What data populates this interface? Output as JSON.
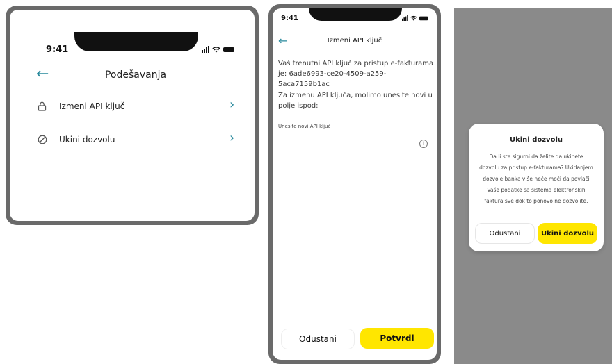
{
  "screen1": {
    "time": "9:41",
    "title": "Podešavanja",
    "items": [
      {
        "label": "Izmeni API ključ",
        "icon": "lock-icon"
      },
      {
        "label": "Ukini dozvolu",
        "icon": "block-icon"
      }
    ]
  },
  "screen2": {
    "time": "9:41",
    "title": "Izmeni API ključ",
    "current_key_text": "Vaš trenutni API ključ za pristup e-fakturama je: 6ade6993-ce20-4509-a259-5aca7159b1ac",
    "instruction": "Za izmenu API ključa, molimo unesite novi u polje ispod:",
    "field_label": "Unesite novi API ključ",
    "field_value": "",
    "cancel_label": "Odustani",
    "confirm_label": "Potvrdi"
  },
  "dialog": {
    "title": "Ukini dozvolu",
    "body": "Da li ste sigurni da želite da ukinete dozvolu za pristup e-fakturama? Ukidanjem dozvole banka više neće moći da povlači Vaše podatke sa sistema elektronskih faktura sve dok to ponovo ne dozvolite.",
    "cancel_label": "Odustani",
    "confirm_label": "Ukini dozvolu"
  },
  "colors": {
    "accent": "#2a8a9d",
    "primary_button": "#ffe600",
    "frame": "#6a6a6a",
    "overlay": "#8a8a8a"
  }
}
